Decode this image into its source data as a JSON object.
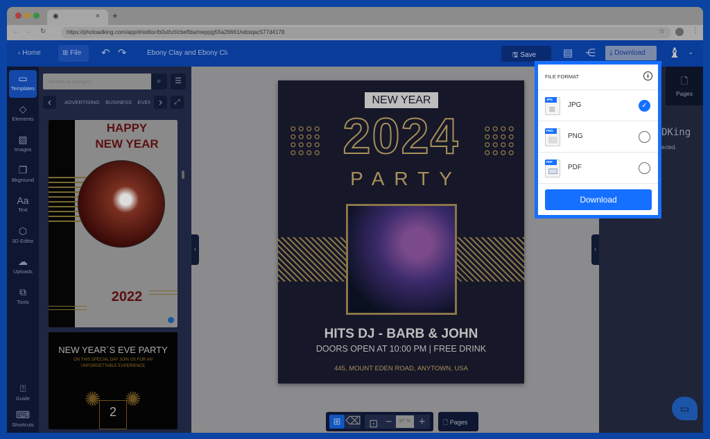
{
  "browser": {
    "url": "https://photoadking.com/app/#/editor/b0uthz0cbeffda/nwppjg55a26661/wbsqac577d4178"
  },
  "header": {
    "home": "Home",
    "file": "File",
    "doc_title": "Ebony Clay and Ebony Clay",
    "save": "Save",
    "download": "Download"
  },
  "rail": {
    "items": [
      {
        "label": "Templates",
        "icon": "▭"
      },
      {
        "label": "Elements",
        "icon": "◇"
      },
      {
        "label": "Images",
        "icon": "▨"
      },
      {
        "label": "Bkground",
        "icon": "❐"
      },
      {
        "label": "Text",
        "icon": "Aa"
      },
      {
        "label": "3D Editor",
        "icon": "⬡"
      },
      {
        "label": "Uploads",
        "icon": "☁"
      },
      {
        "label": "Tools",
        "icon": "⧉"
      }
    ],
    "guide": "Guide",
    "shortcuts": "Shortcuts"
  },
  "panel": {
    "search_placeholder": "Search in category",
    "categories": [
      "ADVERTISING",
      "BUSINESS",
      "EVEN"
    ],
    "t1": {
      "line1": "HAPPY",
      "line2": "NEW YEAR",
      "year": "2022"
    },
    "t2": {
      "title": "NEW YEAR´S EVE PARTY",
      "sub1": "ON THIS SPECIAL DAY JOIN US FOR AN",
      "sub2": "UNFORGETTABLE EXPERIENCE",
      "digit": "2"
    }
  },
  "poster": {
    "tag": "NEW YEAR",
    "year": "2024",
    "party": "PARTY",
    "dj": "HITS DJ  - BARB & JOHN",
    "doors": "DOORS OPEN AT 10:00 PM | FREE DRINK",
    "address": "445, MOUNT EDEN ROAD, ANYTOWN, USA"
  },
  "toolbar": {
    "zoom": "87 %",
    "pages": "Pages"
  },
  "right": {
    "pages": "Pages",
    "brand_partial": "DKing",
    "text_partial": "ected."
  },
  "popup": {
    "title": "FILE FORMAT",
    "options": [
      {
        "label": "JPG",
        "badge": "JPG",
        "selected": true
      },
      {
        "label": "PNG",
        "badge": "PNG",
        "selected": false
      },
      {
        "label": "PDF",
        "badge": "PDF",
        "selected": false
      }
    ],
    "download": "Download"
  },
  "colors": {
    "accent": "#1670ff",
    "frame": "#0b44a3"
  }
}
